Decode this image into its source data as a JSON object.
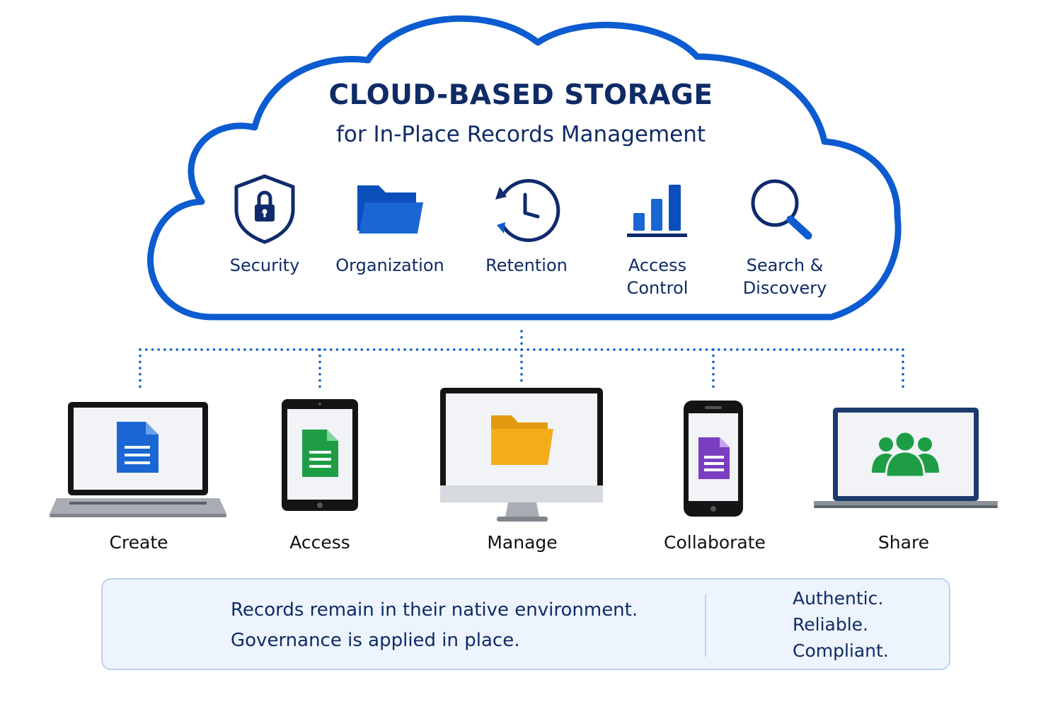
{
  "cloud": {
    "title": "CLOUD-BASED STORAGE",
    "subtitle": "for In-Place Records Management",
    "features": [
      {
        "label": "Security",
        "icon": "shield-lock-icon"
      },
      {
        "label": "Organization",
        "icon": "folder-icon"
      },
      {
        "label": "Retention",
        "icon": "clock-cycle-icon"
      },
      {
        "label": "Access\nControl",
        "icon": "bar-chart-icon"
      },
      {
        "label": "Search &\nDiscovery",
        "icon": "magnifier-icon"
      }
    ]
  },
  "devices": [
    {
      "label": "Create",
      "device": "laptop",
      "icon": "document-icon",
      "color": "#1a66d2"
    },
    {
      "label": "Access",
      "device": "tablet",
      "icon": "document-icon",
      "color": "#1e9d45"
    },
    {
      "label": "Manage",
      "device": "desktop-monitor",
      "icon": "folder-icon",
      "color": "#f3ad18"
    },
    {
      "label": "Collaborate",
      "device": "phone",
      "icon": "document-icon",
      "color": "#7a3fc0"
    },
    {
      "label": "Share",
      "device": "laptop",
      "icon": "people-icon",
      "color": "#1e9d45"
    }
  ],
  "callout": {
    "line1": "Records remain in their native environment.",
    "line2": "Governance is applied in place.",
    "status": [
      "Authentic.",
      "Reliable.",
      "Compliant."
    ]
  },
  "colors": {
    "primary_blue": "#0c5bd0",
    "navy": "#0f2b66",
    "check_green": "#1e9d45"
  }
}
